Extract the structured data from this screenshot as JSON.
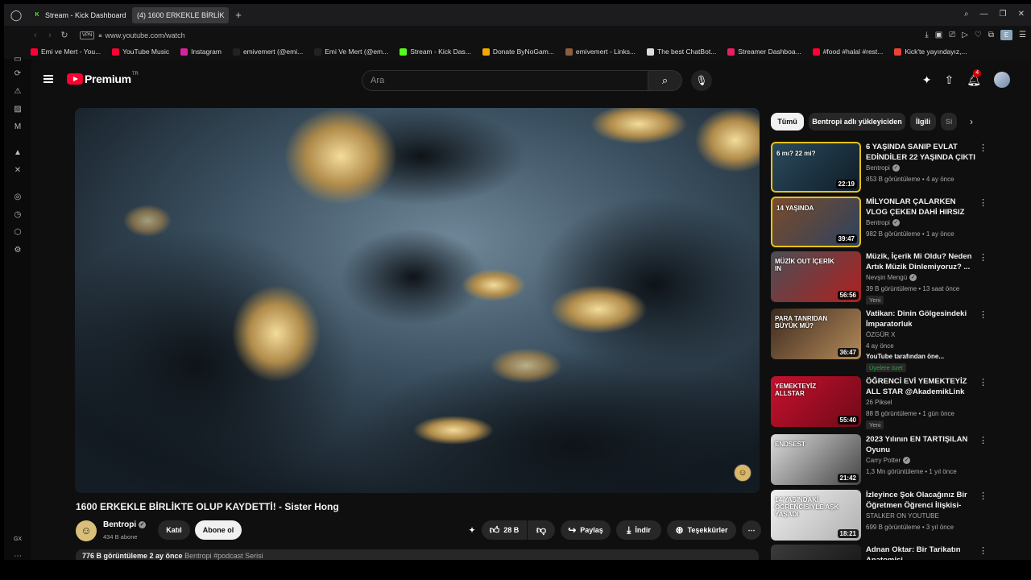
{
  "browser": {
    "tabs": [
      {
        "label": "Stream - Kick Dashboard",
        "icon": "kick-icon"
      },
      {
        "label": "(4) 1600 ERKEKLE BİRLİK",
        "icon": "youtube-icon"
      }
    ],
    "url": "www.youtube.com/watch",
    "vpn": "VPN",
    "profile_initial": "E",
    "bookmarks": [
      {
        "label": "Emi ve Mert - You...",
        "color": "#ff0033"
      },
      {
        "label": "YouTube Music",
        "color": "#ff0033"
      },
      {
        "label": "Instagram",
        "color": "#d6249f"
      },
      {
        "label": "emivemert (@emi...",
        "color": "#222222"
      },
      {
        "label": "Emi Ve Mert (@em...",
        "color": "#222222"
      },
      {
        "label": "Stream - Kick Das...",
        "color": "#53fc18"
      },
      {
        "label": "Donate ByNoGam...",
        "color": "#f2a900"
      },
      {
        "label": "emivemert - Links...",
        "color": "#8b5e3c"
      },
      {
        "label": "The best ChatBot...",
        "color": "#dddddd"
      },
      {
        "label": "Streamer Dashboa...",
        "color": "#e91e63"
      },
      {
        "label": "#food #halal #rest...",
        "color": "#ff0033"
      },
      {
        "label": "Kick'te yayındayız,...",
        "color": "#ea4335"
      }
    ],
    "sidebar_footer": "GX"
  },
  "youtube": {
    "logo": "Premium",
    "logo_sup": "TR",
    "search_placeholder": "Ara",
    "notification_count": "4"
  },
  "video": {
    "title": "1600 ERKEKLE BİRLİKTE OLUP KAYDETTİ! - Sister Hong",
    "channel": "Bentropi",
    "subscribers": "434 B abone",
    "join_label": "Katıl",
    "subscribe_label": "Abone ol",
    "likes": "28 B",
    "share_label": "Paylaş",
    "download_label": "İndir",
    "thanks_label": "Teşekkürler",
    "views_date": "776 B görüntüleme  2 ay önce",
    "desc_tags": "Bentropi  #podcast Serisi"
  },
  "chips": [
    "Tümü",
    "Bentropi adlı yükleyiciden",
    "İlgili",
    "Si"
  ],
  "recommendations": [
    {
      "title": "6 YAŞINDA SANIP EVLAT EDİNDİLER 22 YAŞINDA ÇIKTI",
      "channel": "Bentropi",
      "verified": true,
      "meta": "853 B görüntüleme  •  4 ay önce",
      "duration": "22:19",
      "thumb_text": "6 mı?    22 mi?"
    },
    {
      "title": "MİLYONLAR ÇALARKEN VLOG ÇEKEN DAHİ HIRSIZ",
      "channel": "Bentropi",
      "verified": true,
      "meta": "982 B görüntüleme  •  1 ay önce",
      "duration": "39:47",
      "thumb_text": "14 YAŞINDA"
    },
    {
      "title": "Müzik, İçerik Mi Oldu? Neden Artık Müzik Dinlemiyoruz? ...",
      "channel": "Nevşin Mengü",
      "verified": true,
      "meta": "39 B görüntüleme  •  13 saat önce",
      "duration": "56:56",
      "badge": "Yeni",
      "thumb_text": "MÜZİK OUT İÇERİK IN"
    },
    {
      "title": "Vatikan: Dinin Gölgesindeki İmparatorluk",
      "channel": "ÖZGÜR X",
      "verified": false,
      "meta": "4 ay önce",
      "duration": "36:47",
      "extra": "YouTube tarafından öne...",
      "badge": "Üyelere özel",
      "thumb_text": "PARA TANRIDAN BÜYÜK MÜ?"
    },
    {
      "title": "ÖĞRENCİ EVİ YEMEKTEYİZ ALL STAR @AkademikLink",
      "channel": "26 Piksel",
      "verified": false,
      "meta": "88 B görüntüleme  •  1 gün önce",
      "duration": "55:40",
      "badge": "Yeni",
      "thumb_text": "YEMEKTEYİZ ALLSTAR"
    },
    {
      "title": "2023 Yılının EN TARTIŞILAN Oyunu",
      "channel": "Carry Potter",
      "verified": true,
      "meta": "1,3 Mn görüntüleme  •  1 yıl önce",
      "duration": "21:42",
      "thumb_text": "ENDSEST"
    },
    {
      "title": "İzleyince Şok Olacağınız Bir Öğretmen Öğrenci İlişkisi- Mar...",
      "channel": "STALKER ON YOUTUBE",
      "verified": false,
      "meta": "699 B görüntüleme  •  3 yıl önce",
      "duration": "18:21",
      "thumb_text": "14 YAŞINDAKİ ÖĞRENCİSİYLE AŞK YAŞADI"
    },
    {
      "title": "Adnan Oktar: Bir Tarikatın Anatomisi",
      "channel": "",
      "verified": false,
      "meta": "",
      "duration": "",
      "thumb_text": ""
    }
  ]
}
